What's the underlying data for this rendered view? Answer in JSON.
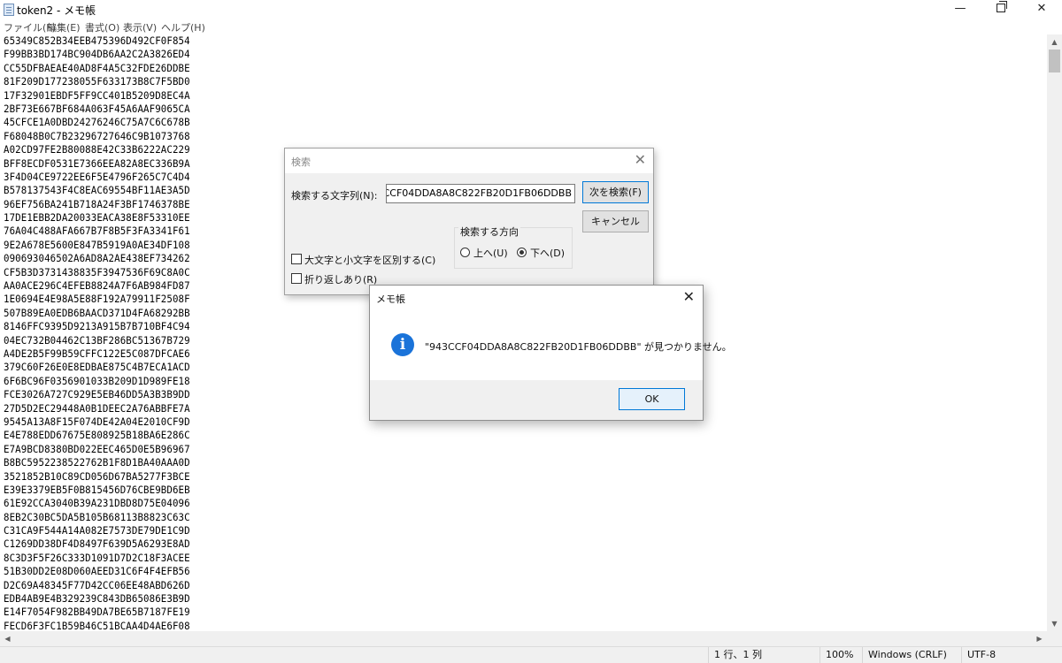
{
  "window": {
    "title": "token2 - メモ帳",
    "minimize": "—",
    "maximize": "",
    "close": "✕"
  },
  "menu": [
    "ファイル(F)",
    "編集(E)",
    "書式(O)",
    "表示(V)",
    "ヘルプ(H)"
  ],
  "document": {
    "lines": [
      "65349C852B34EEB475396D492CF0F854",
      "F99BB3BD174BC904DB6AA2C2A3826ED4",
      "CC55DFBAEAE40AD8F4A5C32FDE26DDBE",
      "81F209D177238055F633173B8C7F5BD0",
      "17F32901EBDF5FF9CC401B5209D8EC4A",
      "2BF73E667BF684A063F45A6AAF9065CA",
      "45CFCE1A0DBD24276246C75A7C6C678B",
      "F68048B0C7B23296727646C9B1073768",
      "A02CD97FE2B80088E42C33B6222AC229",
      "BFF8ECDF0531E7366EEA82A8EC336B9A",
      "3F4D04CE9722EE6F5E4796F265C7C4D4",
      "B578137543F4C8EAC69554BF11AE3A5D",
      "96EF756BA241B718A24F3BF1746378BE",
      "17DE1EBB2DA20033EACA38E8F53310EE",
      "76A04C488AFA667B7F8B5F3FA3341F61",
      "9E2A678E5600E847B5919A0AE34DF108",
      "090693046502A6AD8A2AE438EF734262",
      "CF5B3D3731438835F3947536F69C8A0C",
      "AA0ACE296C4EFEB8824A7F6AB984FD87",
      "1E0694E4E98A5E88F192A79911F2508F",
      "507B89EA0EDB6BAACD371D4FA68292BB",
      "8146FFC9395D9213A915B7B710BF4C94",
      "04EC732B04462C13BF286BC51367B729",
      "A4DE2B5F99B59CFFC122E5C087DFCAE6",
      "379C60F26E0E8EDBAE875C4B7ECA1ACD",
      "6F6BC96F0356901033B209D1D989FE18",
      "FCE3026A727C929E5EB46DD5A3B3B9DD",
      "27D5D2EC29448A0B1DEEC2A76ABBFE7A",
      "9545A13A8F15F074DE42A04E2010CF9D",
      "E4E788EDD67675E808925B18BA6E286C",
      "E7A9BCD8380BD022EEC465D0E5B96967",
      "B8BC5952238522762B1F8D1BA40AAA0D",
      "3521852B10C89CD056D67BA5277F3BCE",
      "E39E3379EB5F0B815456D76CBE9BD6EB",
      "61E92CCA3040B39A231DBD8D75E04096",
      "8EB2C30BC5DA5B105B68113B8823C63C",
      "C31CA9F544A14A082E7573DE79DE1C9D",
      "C1269DD38DF4D8497F639D5A6293E8AD",
      "8C3D3F5F26C333D1091D7D2C18F3ACEE",
      "51B30DD2E08D060AEED31C6F4F4EFB56",
      "D2C69A48345F77D42CC06EE48ABD626D",
      "EDB4AB9E4B329239C843DB65086E3B9D",
      "E14F7054F982BB49DA7BE65B7187FE19",
      "FECD6F3FC1B59B46C51BCAA4D4AE6F08"
    ]
  },
  "find_dialog": {
    "title": "検索",
    "search_label": "検索する文字列(N):",
    "search_value": "943CCF04DDA8A8C822FB20D1FB06DDBB",
    "find_next": "次を検索(F)",
    "cancel": "キャンセル",
    "direction_label": "検索する方向",
    "direction_up": "上へ(U)",
    "direction_down": "下へ(D)",
    "direction_selected": "down",
    "match_case": "大文字と小文字を区別する(C)",
    "wrap_around": "折り返しあり(R)"
  },
  "message_box": {
    "title": "メモ帳",
    "message": "\"943CCF04DDA8A8C822FB20D1FB06DDBB\" が見つかりません。",
    "ok": "OK",
    "icon": "info-icon"
  },
  "status": {
    "position": "1 行、1 列",
    "zoom": "100%",
    "line_ending": "Windows (CRLF)",
    "encoding": "UTF-8"
  },
  "colors": {
    "accent": "#0078d7",
    "info_icon": "#1a73d9"
  }
}
